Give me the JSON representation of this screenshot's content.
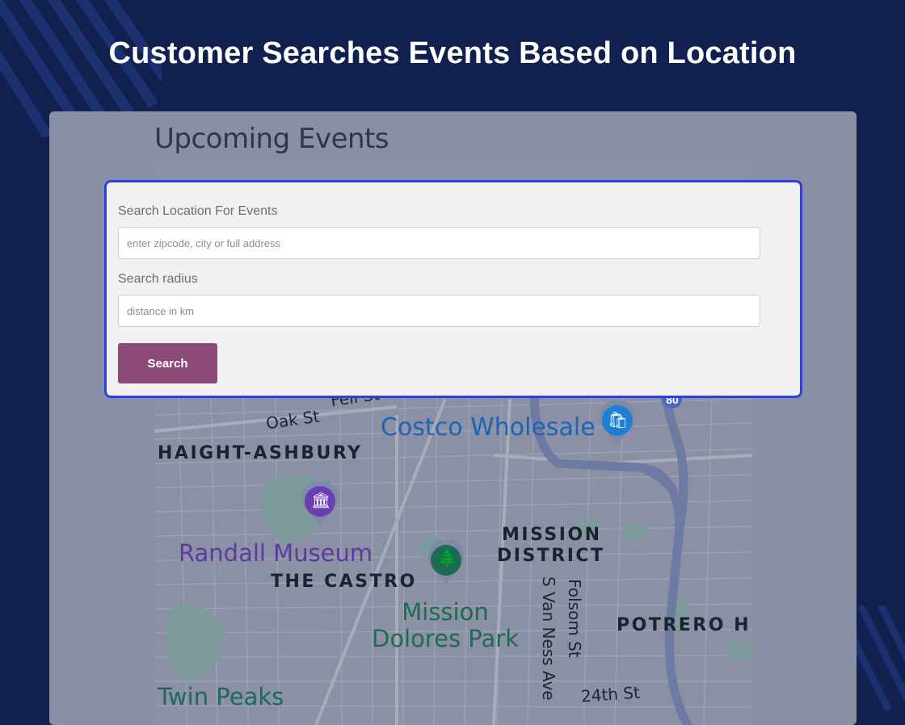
{
  "header": {
    "title": "Customer Searches Events Based on Location"
  },
  "page": {
    "title": "Upcoming Events"
  },
  "search": {
    "location_label": "Search Location For Events",
    "location_placeholder": "enter zipcode, city or full address",
    "location_value": "",
    "radius_label": "Search radius",
    "radius_placeholder": "distance in km",
    "radius_value": "",
    "button_label": "Search"
  },
  "map": {
    "districts": [
      "HAIGHT-ASHBURY",
      "MISSION",
      "DISTRICT",
      "THE CASTRO",
      "POTRERO HI"
    ],
    "streets": [
      "Fell St",
      "Oak St",
      "S Van Ness Ave",
      "Folsom St",
      "24th St"
    ],
    "highway_shield": "80",
    "pois": [
      {
        "name": "Costco Wholesale",
        "icon": "shopping-bag-icon",
        "color": "#1e64b8"
      },
      {
        "name": "Randall Museum",
        "icon": "museum-icon",
        "color": "#6a3fb5"
      },
      {
        "name_line1": "Mission",
        "name_line2": "Dolores Park",
        "icon": "tree-icon",
        "color": "#1c6b55"
      },
      {
        "name": "Twin Peaks",
        "color": "#1c6b55"
      }
    ]
  },
  "colors": {
    "background": "#11204f",
    "overlay": "#8a90a3",
    "accent_border": "#2d3fe0",
    "button": "#8e4a76"
  }
}
